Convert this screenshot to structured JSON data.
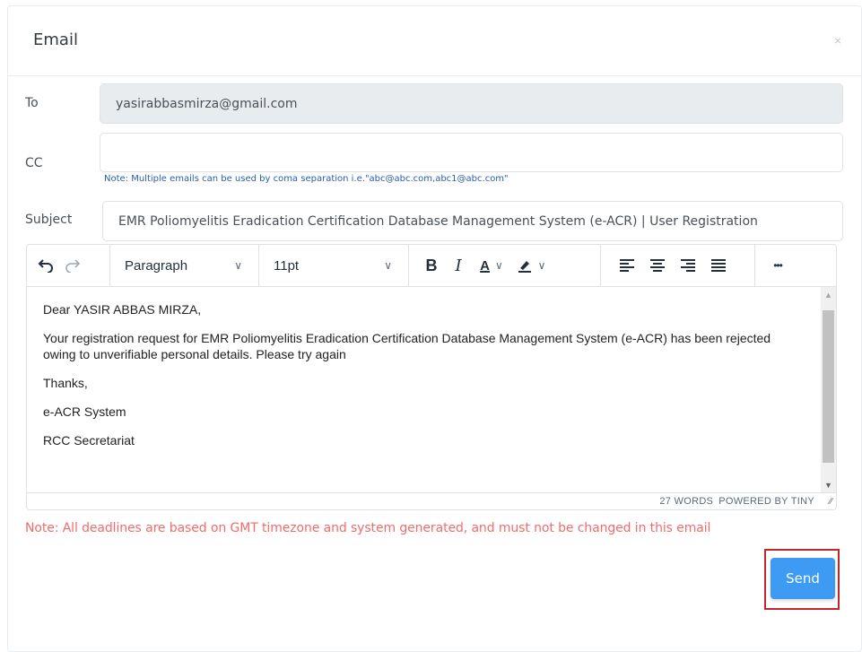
{
  "modal": {
    "title": "Email",
    "close_glyph": "×"
  },
  "form": {
    "to_label": "To",
    "to_value": "yasirabbasmirza@gmail.com",
    "cc_label": "CC",
    "cc_value": "",
    "cc_note": "Note: Multiple emails can be used by coma separation i.e.\"abc@abc.com,abc1@abc.com\"",
    "subject_label": "Subject",
    "subject_value": "EMR Poliomyelitis Eradication Certification Database Management System (e-ACR) | User Registration"
  },
  "editor": {
    "toolbar": {
      "block_format": "Paragraph",
      "font_size": "11pt",
      "more_glyph": "•••"
    },
    "body": {
      "greeting": "Dear YASIR ABBAS MIRZA,",
      "message": "Your registration request for EMR Poliomyelitis Eradication Certification Database Management System (e-ACR) has been rejected owing to unverifiable personal details. Please try again",
      "closing": "Thanks,",
      "signature_1": "e-ACR System",
      "signature_2": "RCC Secretariat"
    },
    "status": {
      "word_count": "27 WORDS",
      "powered_by": "POWERED BY TINY"
    }
  },
  "note": "Note: All deadlines are based on GMT timezone and system generated, and must not be changed in this email",
  "actions": {
    "send_label": "Send"
  },
  "colors": {
    "accent": "#3d9bf4",
    "note_red": "#f26c6c",
    "highlight_border": "#c0272d"
  }
}
